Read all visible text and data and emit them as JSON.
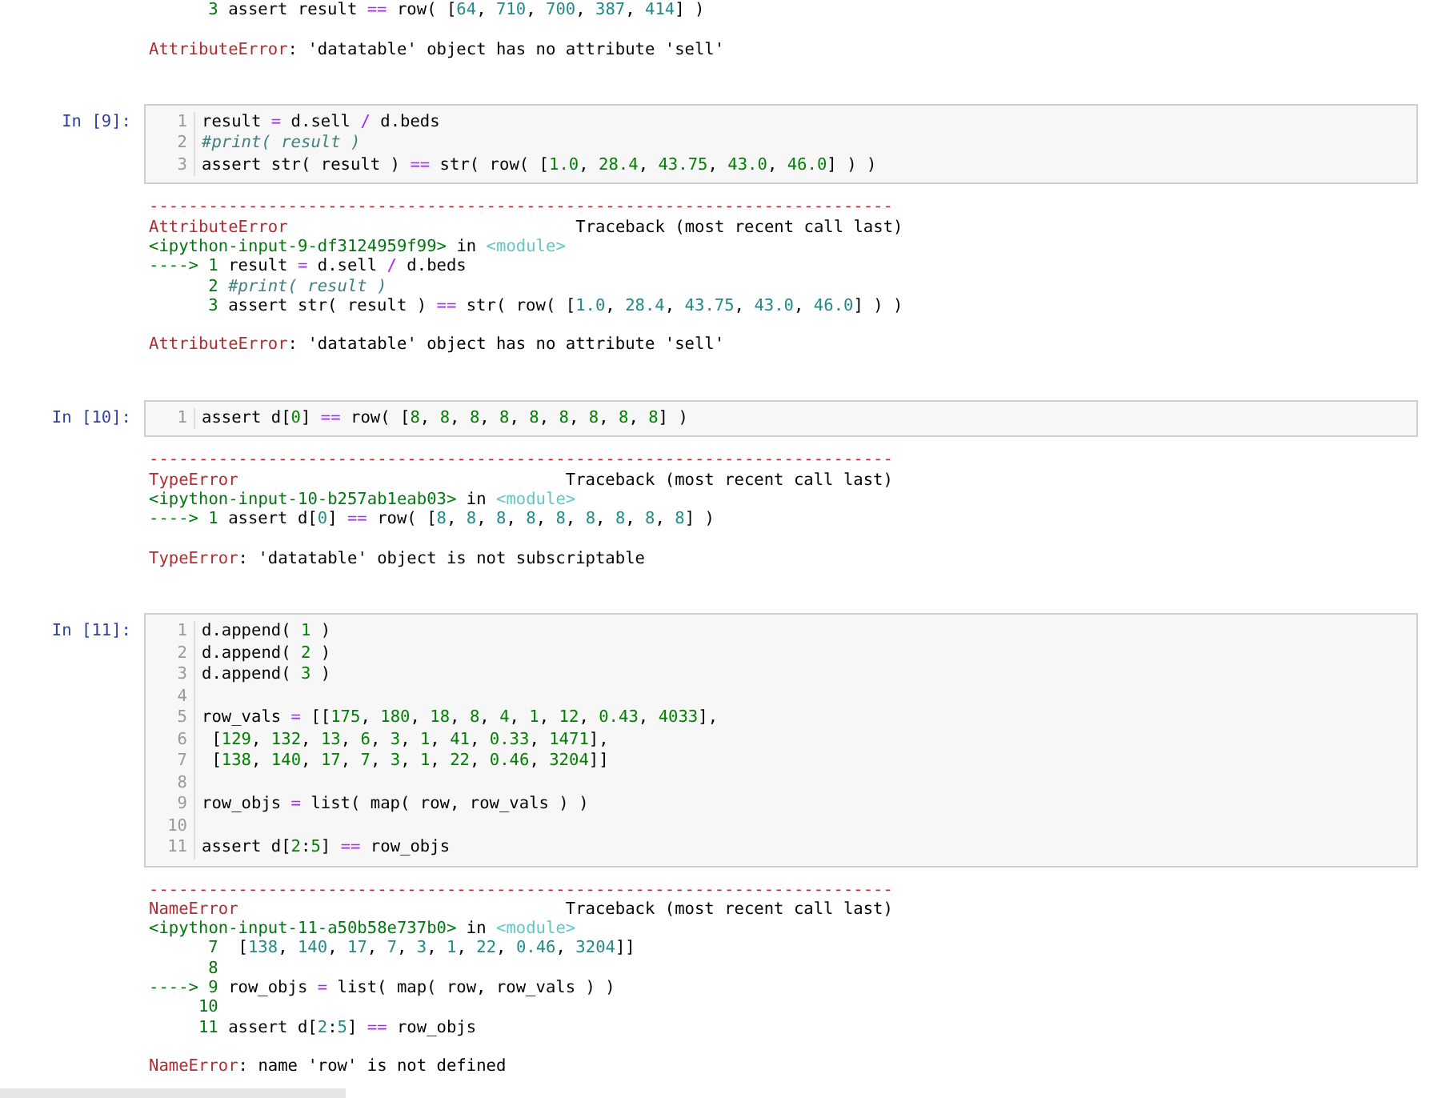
{
  "previous_output": {
    "lines": [
      {
        "number": "3",
        "code": "assert result == row( [64, 710, 700, 387, 414] )"
      }
    ],
    "error_line": "AttributeError: 'datatable' object has no attribute 'sell'"
  },
  "cells": [
    {
      "prompt": "In [9]:",
      "code": [
        {
          "number": "1",
          "code": "result = d.sell / d.beds"
        },
        {
          "number": "2",
          "code": "#print( result )"
        },
        {
          "number": "3",
          "code": "assert str( result ) == str( row( [1.0, 28.4, 43.75, 43.0, 46.0] ) )"
        }
      ],
      "output": {
        "rule": "---------------------------------------------------------------------------",
        "error_type": "AttributeError",
        "traceback_title": "Traceback (most recent call last)",
        "location": "<ipython-input-9-df3124959f99>",
        "location_in": "in",
        "location_scope": "<module>",
        "lines": [
          {
            "arrow": "---->",
            "number": "1",
            "code": "result = d.sell / d.beds"
          },
          {
            "number": "2",
            "code": "#print( result )"
          },
          {
            "number": "3",
            "code": "assert str( result ) == str( row( [1.0, 28.4, 43.75, 43.0, 46.0] ) )"
          }
        ],
        "error_line": "AttributeError: 'datatable' object has no attribute 'sell'"
      }
    },
    {
      "prompt": "In [10]:",
      "code": [
        {
          "number": "1",
          "code": "assert d[0] == row( [8, 8, 8, 8, 8, 8, 8, 8, 8] )"
        }
      ],
      "output": {
        "rule": "---------------------------------------------------------------------------",
        "error_type": "TypeError",
        "traceback_title": "Traceback (most recent call last)",
        "location": "<ipython-input-10-b257ab1eab03>",
        "location_in": "in",
        "location_scope": "<module>",
        "lines": [
          {
            "arrow": "---->",
            "number": "1",
            "code": "assert d[0] == row( [8, 8, 8, 8, 8, 8, 8, 8, 8] )"
          }
        ],
        "error_line": "TypeError: 'datatable' object is not subscriptable"
      }
    },
    {
      "prompt": "In [11]:",
      "code": [
        {
          "number": "1",
          "code": "d.append( 1 )"
        },
        {
          "number": "2",
          "code": "d.append( 2 )"
        },
        {
          "number": "3",
          "code": "d.append( 3 )"
        },
        {
          "number": "4"
        },
        {
          "number": "5",
          "code": "row_vals = [[175, 180, 18, 8, 4, 1, 12, 0.43, 4033],"
        },
        {
          "number": "6",
          "code": " [129, 132, 13, 6, 3, 1, 41, 0.33, 1471],"
        },
        {
          "number": "7",
          "code": " [138, 140, 17, 7, 3, 1, 22, 0.46, 3204]]"
        },
        {
          "number": "8"
        },
        {
          "number": "9",
          "code": "row_objs = list( map( row, row_vals ) )"
        },
        {
          "number": "10"
        },
        {
          "number": "11",
          "code": "assert d[2:5] == row_objs"
        }
      ],
      "output": {
        "rule": "---------------------------------------------------------------------------",
        "error_type": "NameError",
        "traceback_title": "Traceback (most recent call last)",
        "location": "<ipython-input-11-a50b58e737b0>",
        "location_in": "in",
        "location_scope": "<module>",
        "lines": [
          {
            "number": "7",
            "code": " [138, 140, 17, 7, 3, 1, 22, 0.46, 3204]]"
          },
          {
            "number": "8"
          },
          {
            "arrow": "---->",
            "number": "9",
            "code": "row_objs = list( map( row, row_vals ) )"
          },
          {
            "number": "10"
          },
          {
            "number": "11",
            "code": "assert d[2:5] == row_objs"
          }
        ],
        "error_line": "NameError: name 'row' is not defined"
      }
    }
  ]
}
